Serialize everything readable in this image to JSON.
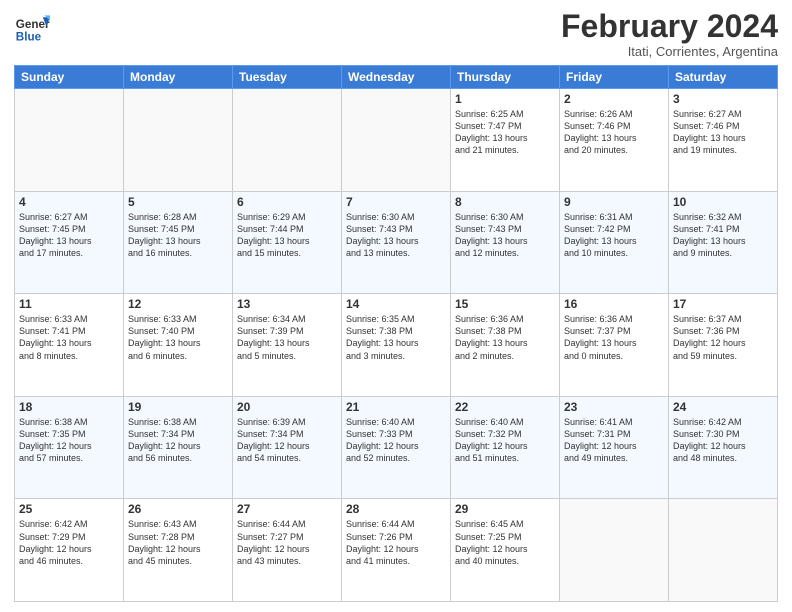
{
  "logo": {
    "general": "General",
    "blue": "Blue"
  },
  "header": {
    "month_year": "February 2024",
    "location": "Itati, Corrientes, Argentina"
  },
  "days_of_week": [
    "Sunday",
    "Monday",
    "Tuesday",
    "Wednesday",
    "Thursday",
    "Friday",
    "Saturday"
  ],
  "weeks": [
    {
      "days": [
        {
          "number": "",
          "info": ""
        },
        {
          "number": "",
          "info": ""
        },
        {
          "number": "",
          "info": ""
        },
        {
          "number": "",
          "info": ""
        },
        {
          "number": "1",
          "info": "Sunrise: 6:25 AM\nSunset: 7:47 PM\nDaylight: 13 hours\nand 21 minutes."
        },
        {
          "number": "2",
          "info": "Sunrise: 6:26 AM\nSunset: 7:46 PM\nDaylight: 13 hours\nand 20 minutes."
        },
        {
          "number": "3",
          "info": "Sunrise: 6:27 AM\nSunset: 7:46 PM\nDaylight: 13 hours\nand 19 minutes."
        }
      ]
    },
    {
      "days": [
        {
          "number": "4",
          "info": "Sunrise: 6:27 AM\nSunset: 7:45 PM\nDaylight: 13 hours\nand 17 minutes."
        },
        {
          "number": "5",
          "info": "Sunrise: 6:28 AM\nSunset: 7:45 PM\nDaylight: 13 hours\nand 16 minutes."
        },
        {
          "number": "6",
          "info": "Sunrise: 6:29 AM\nSunset: 7:44 PM\nDaylight: 13 hours\nand 15 minutes."
        },
        {
          "number": "7",
          "info": "Sunrise: 6:30 AM\nSunset: 7:43 PM\nDaylight: 13 hours\nand 13 minutes."
        },
        {
          "number": "8",
          "info": "Sunrise: 6:30 AM\nSunset: 7:43 PM\nDaylight: 13 hours\nand 12 minutes."
        },
        {
          "number": "9",
          "info": "Sunrise: 6:31 AM\nSunset: 7:42 PM\nDaylight: 13 hours\nand 10 minutes."
        },
        {
          "number": "10",
          "info": "Sunrise: 6:32 AM\nSunset: 7:41 PM\nDaylight: 13 hours\nand 9 minutes."
        }
      ]
    },
    {
      "days": [
        {
          "number": "11",
          "info": "Sunrise: 6:33 AM\nSunset: 7:41 PM\nDaylight: 13 hours\nand 8 minutes."
        },
        {
          "number": "12",
          "info": "Sunrise: 6:33 AM\nSunset: 7:40 PM\nDaylight: 13 hours\nand 6 minutes."
        },
        {
          "number": "13",
          "info": "Sunrise: 6:34 AM\nSunset: 7:39 PM\nDaylight: 13 hours\nand 5 minutes."
        },
        {
          "number": "14",
          "info": "Sunrise: 6:35 AM\nSunset: 7:38 PM\nDaylight: 13 hours\nand 3 minutes."
        },
        {
          "number": "15",
          "info": "Sunrise: 6:36 AM\nSunset: 7:38 PM\nDaylight: 13 hours\nand 2 minutes."
        },
        {
          "number": "16",
          "info": "Sunrise: 6:36 AM\nSunset: 7:37 PM\nDaylight: 13 hours\nand 0 minutes."
        },
        {
          "number": "17",
          "info": "Sunrise: 6:37 AM\nSunset: 7:36 PM\nDaylight: 12 hours\nand 59 minutes."
        }
      ]
    },
    {
      "days": [
        {
          "number": "18",
          "info": "Sunrise: 6:38 AM\nSunset: 7:35 PM\nDaylight: 12 hours\nand 57 minutes."
        },
        {
          "number": "19",
          "info": "Sunrise: 6:38 AM\nSunset: 7:34 PM\nDaylight: 12 hours\nand 56 minutes."
        },
        {
          "number": "20",
          "info": "Sunrise: 6:39 AM\nSunset: 7:34 PM\nDaylight: 12 hours\nand 54 minutes."
        },
        {
          "number": "21",
          "info": "Sunrise: 6:40 AM\nSunset: 7:33 PM\nDaylight: 12 hours\nand 52 minutes."
        },
        {
          "number": "22",
          "info": "Sunrise: 6:40 AM\nSunset: 7:32 PM\nDaylight: 12 hours\nand 51 minutes."
        },
        {
          "number": "23",
          "info": "Sunrise: 6:41 AM\nSunset: 7:31 PM\nDaylight: 12 hours\nand 49 minutes."
        },
        {
          "number": "24",
          "info": "Sunrise: 6:42 AM\nSunset: 7:30 PM\nDaylight: 12 hours\nand 48 minutes."
        }
      ]
    },
    {
      "days": [
        {
          "number": "25",
          "info": "Sunrise: 6:42 AM\nSunset: 7:29 PM\nDaylight: 12 hours\nand 46 minutes."
        },
        {
          "number": "26",
          "info": "Sunrise: 6:43 AM\nSunset: 7:28 PM\nDaylight: 12 hours\nand 45 minutes."
        },
        {
          "number": "27",
          "info": "Sunrise: 6:44 AM\nSunset: 7:27 PM\nDaylight: 12 hours\nand 43 minutes."
        },
        {
          "number": "28",
          "info": "Sunrise: 6:44 AM\nSunset: 7:26 PM\nDaylight: 12 hours\nand 41 minutes."
        },
        {
          "number": "29",
          "info": "Sunrise: 6:45 AM\nSunset: 7:25 PM\nDaylight: 12 hours\nand 40 minutes."
        },
        {
          "number": "",
          "info": ""
        },
        {
          "number": "",
          "info": ""
        }
      ]
    }
  ]
}
